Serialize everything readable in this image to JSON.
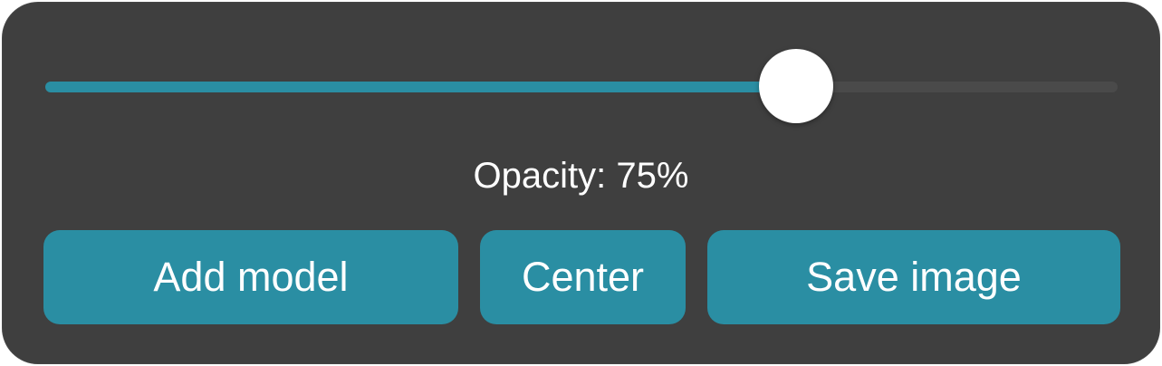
{
  "colors": {
    "panel_bg": "#3f3f3f",
    "accent": "#2a8ea3",
    "track_bg": "#4a4a4a",
    "thumb": "#ffffff",
    "text": "#ffffff"
  },
  "slider": {
    "value": 0.7,
    "fill_color": "#2a8ea3"
  },
  "opacity_label": "Opacity: 75%",
  "buttons": {
    "add_model": "Add model",
    "center": "Center",
    "save_image": "Save image"
  }
}
